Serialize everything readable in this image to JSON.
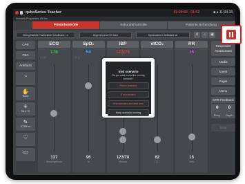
{
  "statusbar": {
    "app_title": "quboSeries Teacher",
    "recording_time": "01:20:50 - 01:52",
    "right": "■ ● 11:34 33"
  },
  "subheader": "Scenario-Programme, 05 Sec",
  "tabs": [
    "Primärkontrolle",
    "Sekundärkontrolle",
    "Patiente Behandlung"
  ],
  "toolbar": {
    "chips": [
      "Sitting Sitzhilfe Positionierte Schulboard, Lv",
      "Abgemessene O2 Gabe",
      "Sportnutzen & Selbstlaut sei"
    ],
    "icons": [
      "↺",
      "⌂",
      "▣"
    ]
  },
  "sidebar": {
    "text_items": [
      "CPR",
      "PEA",
      "Artefacts"
    ],
    "icon_items": [
      {
        "glyph": "◔",
        "label": "",
        "sub": ""
      },
      {
        "glyph": "✋",
        "label": "None",
        "sub": ""
      },
      {
        "glyph": "⚘",
        "label": "36.4 °C",
        "sub": ""
      },
      {
        "glyph": "✎",
        "label": "3,700 ml",
        "sub": ""
      },
      {
        "glyph": "♡",
        "label": "",
        "sub": ""
      },
      {
        "glyph": "⬭",
        "label": "",
        "sub": ""
      }
    ]
  },
  "vitals": [
    {
      "name": "ECG",
      "value": "176",
      "value_color": "#33cc4a",
      "trend": "││││",
      "bottom_value": "137",
      "bottom_label": "Sinusrhythmus"
    },
    {
      "name": "SpO₂",
      "value": "54",
      "value_color": "#3aa0e6",
      "trend": "│││",
      "bottom_value": "96",
      "bottom_label": "%"
    },
    {
      "name": "IBP",
      "value": "123/79",
      "value_color": "#d34040",
      "trend": "",
      "bottom_value": "123/78",
      "bottom_label": "Normal"
    },
    {
      "name": "etCO₂",
      "value": "",
      "value_color": "#e0c84a",
      "trend": "",
      "bottom_value": "62",
      "bottom_label": "││││"
    },
    {
      "name": "RR",
      "value": "15",
      "value_color": "#c64fc6",
      "trend": "",
      "bottom_value": "15",
      "bottom_label": "/min"
    }
  ],
  "rightpanel": {
    "resp": "Responder Assessment",
    "buttons": [
      "Media",
      "Event",
      "Pager",
      "Menu"
    ],
    "cpr_title": "CPR Feedback",
    "cpr_values": [
      "0",
      "0"
    ],
    "cpr_labels": [
      "Freq.",
      "Depth"
    ],
    "end": "Stop"
  },
  "dialog": {
    "title": "End scenario",
    "message": "Do you want to end the running scenario?",
    "options": [
      "Pause scenario",
      "End scenario",
      "End scenario and start new"
    ],
    "keep": "Keep scenario running"
  },
  "colors": {
    "accent": "#c8352f",
    "alarm": "#ff5a5a"
  }
}
